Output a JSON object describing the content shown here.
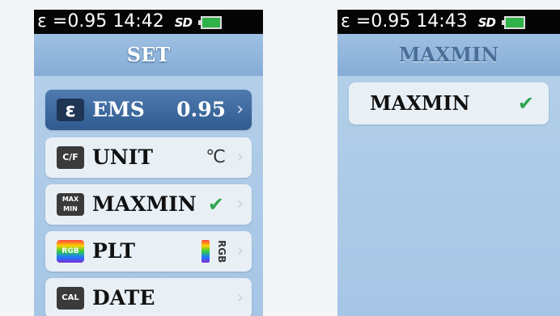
{
  "left_screen": {
    "status": {
      "emissivity": "ε =0.95",
      "time": "14:42",
      "sd": "SD"
    },
    "title": "SET",
    "items": [
      {
        "icon": "ε",
        "label": "EMS",
        "value": "0.95",
        "selected": true
      },
      {
        "icon": "C/F",
        "label": "UNIT",
        "value": "℃"
      },
      {
        "icon": "MAX MIN",
        "label": "MAXMIN",
        "checked": true
      },
      {
        "icon": "RGB",
        "label": "PLT",
        "value_text": "RGB"
      },
      {
        "icon": "CAL",
        "label": "DATE"
      }
    ]
  },
  "right_screen": {
    "status": {
      "emissivity": "ε =0.95",
      "time": "14:43",
      "sd": "SD"
    },
    "title": "MAXMIN",
    "options": [
      {
        "label": "MAXMIN",
        "checked": true
      }
    ]
  },
  "icons": {
    "chevron": "›",
    "check": "✔"
  },
  "colors": {
    "status_bar": "#050505",
    "screen_bg": "#a8c8e8",
    "selected_item": "#3a6599",
    "check": "#2ea44f",
    "battery": "#2fb24a"
  }
}
